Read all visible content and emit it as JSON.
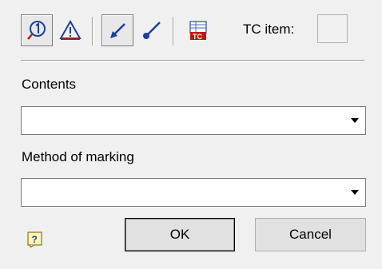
{
  "toolbar": {
    "buttons": [
      {
        "icon": "roughness-symbol-icon",
        "pressed": true
      },
      {
        "icon": "warning-triangle-icon",
        "pressed": false
      },
      {
        "icon": "leader-arrow-icon",
        "pressed": true
      },
      {
        "icon": "leader-dot-icon",
        "pressed": false
      },
      {
        "icon": "tc-table-icon",
        "pressed": false
      }
    ],
    "tc_item_label": "TC item:",
    "tc_item_value": ""
  },
  "contents": {
    "label": "Contents",
    "value": ""
  },
  "method_of_marking": {
    "label": "Method of marking",
    "value": ""
  },
  "footer": {
    "help_icon": "help-icon",
    "ok_label": "OK",
    "cancel_label": "Cancel"
  },
  "colors": {
    "background": "#f0f0f0",
    "icon_blue": "#1a3fa0",
    "icon_red": "#cc1111"
  }
}
